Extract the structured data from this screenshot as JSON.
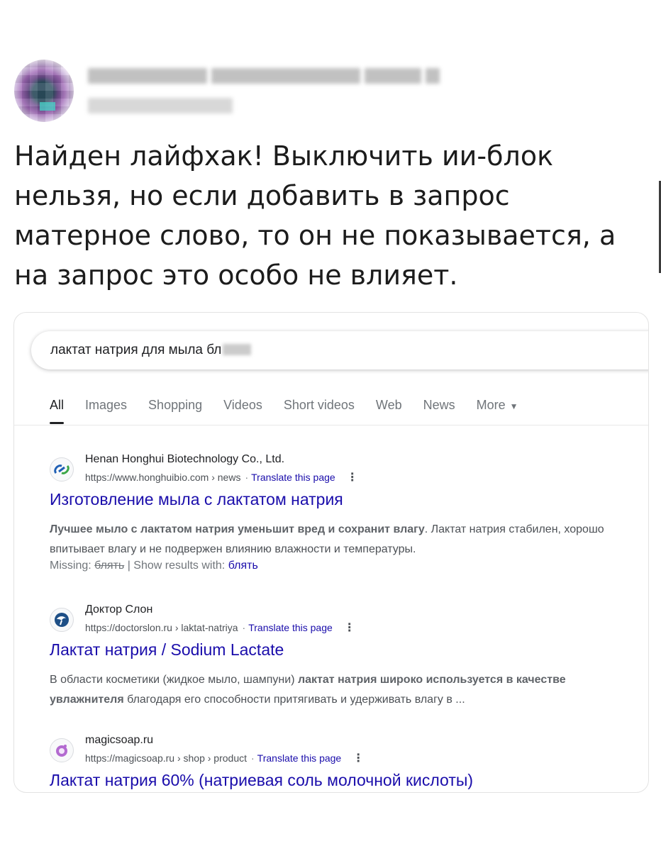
{
  "post": {
    "text": "Найден лайфхак! Выключить ии-блок нельзя, но если добавить в запрос матерное слово, то он не показывается, а на запрос это особо не влияет."
  },
  "search": {
    "query": "лактат натрия для мыла бл"
  },
  "tabs": [
    {
      "label": "All"
    },
    {
      "label": "Images"
    },
    {
      "label": "Shopping"
    },
    {
      "label": "Videos"
    },
    {
      "label": "Short videos"
    },
    {
      "label": "Web"
    },
    {
      "label": "News"
    },
    {
      "label": "More"
    }
  ],
  "results": [
    {
      "site_name": "Henan Honghui Biotechnology Co., Ltd.",
      "url": "https://www.honghuibio.com › news",
      "translate": "Translate this page",
      "title": "Изготовление мыла с лактатом натрия",
      "snippet_bold": "Лучшее мыло с лактатом натрия уменьшит вред и сохранит влагу",
      "snippet_rest": ". Лактат натрия стабилен, хорошо впитывает влагу и не подвержен влиянию влажности и температуры.",
      "missing_label": "Missing:",
      "missing_word": "блять",
      "show_label": "| Show results with:",
      "show_word": "блять"
    },
    {
      "site_name": "Доктор Слон",
      "url": "https://doctorslon.ru › laktat-natriya",
      "translate": "Translate this page",
      "title": "Лактат натрия / Sodium Lactate",
      "snippet_a": "В области косметики (жидкое мыло, шампуни) ",
      "snippet_b": "лактат натрия широко используется в качестве увлажнителя",
      "snippet_c": " благодаря его способности притягивать и удерживать влагу в ..."
    },
    {
      "site_name": "magicsoap.ru",
      "url": "https://magicsoap.ru › shop › product",
      "translate": "Translate this page",
      "title": "Лактат натрия 60% (натриевая соль молочной кислоты)"
    }
  ]
}
